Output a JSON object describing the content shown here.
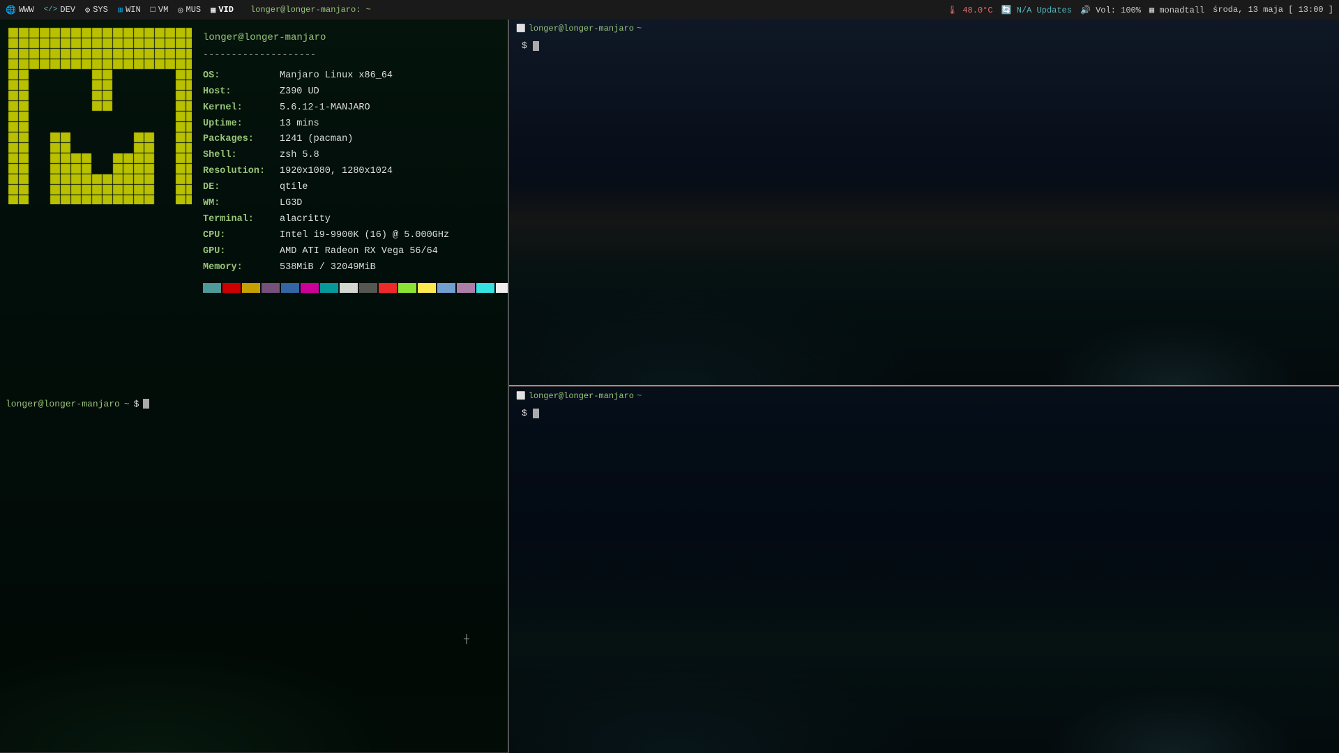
{
  "topbar": {
    "items": [
      {
        "id": "www",
        "label": "WWW",
        "icon": "globe"
      },
      {
        "id": "dev",
        "label": "DEV",
        "icon": "dev"
      },
      {
        "id": "sys",
        "label": "SYS",
        "icon": "gear"
      },
      {
        "id": "win",
        "label": "WIN",
        "icon": "windows"
      },
      {
        "id": "vm",
        "label": "VM",
        "icon": "vm"
      },
      {
        "id": "mus",
        "label": "MUS",
        "icon": "music"
      },
      {
        "id": "vid",
        "label": "VID",
        "icon": "grid",
        "active": true
      }
    ],
    "host_info": "longer@longer-manjaro: ~",
    "temp": "48.0°C",
    "updates": "N/A Updates",
    "volume": "Vol: 100%",
    "layout": "monadtall",
    "datetime": "środa, 13 maja [ 13:00 ]"
  },
  "neofetch": {
    "username": "longer@longer-manjaro",
    "divider": "--------------------",
    "fields": [
      {
        "key": "OS:",
        "val": "Manjaro Linux x86_64"
      },
      {
        "key": "Host:",
        "val": "Z390 UD"
      },
      {
        "key": "Kernel:",
        "val": "5.6.12-1-MANJARO"
      },
      {
        "key": "Uptime:",
        "val": "13 mins"
      },
      {
        "key": "Packages:",
        "val": "1241 (pacman)"
      },
      {
        "key": "Shell:",
        "val": "zsh 5.8"
      },
      {
        "key": "Resolution:",
        "val": "1920x1080, 1280x1024"
      },
      {
        "key": "DE:",
        "val": "qtile"
      },
      {
        "key": "WM:",
        "val": "LG3D"
      },
      {
        "key": "Terminal:",
        "val": "alacritty"
      },
      {
        "key": "CPU:",
        "val": "Intel i9-9900K (16) @ 5.000GHz"
      },
      {
        "key": "GPU:",
        "val": "AMD ATI Radeon RX Vega 56/64"
      },
      {
        "key": "Memory:",
        "val": "538MiB / 32049MiB"
      }
    ],
    "swatches": [
      "#4e9a9a",
      "#cc0000",
      "#c4a000",
      "#75507b",
      "#3465a4",
      "#cc0099",
      "#06989a",
      "#d3d7cf",
      "#555753",
      "#ef2929",
      "#8ae234",
      "#fce94f",
      "#729fcf",
      "#ad7fa8",
      "#34e2e2",
      "#eeeeec"
    ]
  },
  "panels": {
    "tl_prompt": "longer@longer-manjaro",
    "tr_prompt": "longer@longer-manjaro",
    "br_prompt": "longer@longer-manjaro"
  }
}
